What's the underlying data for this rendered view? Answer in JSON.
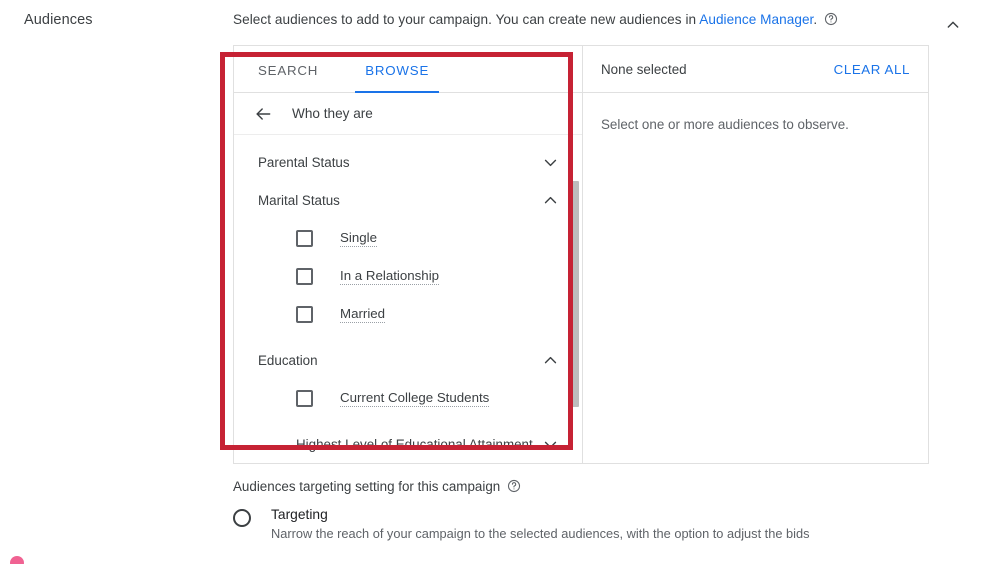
{
  "header": {
    "section_label": "Audiences",
    "description_prefix": "Select audiences to add to your campaign. You can create new audiences in ",
    "link_text": "Audience Manager",
    "description_suffix": ".",
    "help_icon": "help-circle-icon",
    "collapse_icon": "chevron-up-icon"
  },
  "browse_panel": {
    "tabs": [
      {
        "label": "SEARCH",
        "active": false
      },
      {
        "label": "BROWSE",
        "active": true
      }
    ],
    "breadcrumb": {
      "back_icon": "arrow-left-icon",
      "label": "Who they are"
    },
    "items": [
      {
        "type": "group",
        "label": "Parental Status",
        "expanded": false,
        "icon": "chevron-down-icon",
        "indent": false
      },
      {
        "type": "group",
        "label": "Marital Status",
        "expanded": true,
        "icon": "chevron-up-icon",
        "indent": false
      },
      {
        "type": "checkbox",
        "label": "Single",
        "checked": false
      },
      {
        "type": "checkbox",
        "label": "In a Relationship",
        "checked": false
      },
      {
        "type": "checkbox",
        "label": "Married",
        "checked": false
      },
      {
        "type": "group",
        "label": "Education",
        "expanded": true,
        "icon": "chevron-up-icon",
        "indent": false
      },
      {
        "type": "checkbox",
        "label": "Current College Students",
        "checked": false
      },
      {
        "type": "group",
        "label": "Highest Level of Educational Attainment",
        "expanded": false,
        "icon": "chevron-down-icon",
        "indent": true
      }
    ]
  },
  "selection_panel": {
    "count_label": "None selected",
    "clear_all_label": "CLEAR ALL",
    "empty_text": "Select one or more audiences to observe."
  },
  "targeting": {
    "title": "Audiences targeting setting for this campaign",
    "help_icon": "help-circle-icon",
    "option_title": "Targeting",
    "option_description": "Narrow the reach of your campaign to the selected audiences, with the option to adjust the bids",
    "selected": false
  },
  "colors": {
    "accent_blue": "#1a73e8",
    "annotation_red": "#c62234",
    "text_primary": "#3c4043",
    "text_secondary": "#5f6368",
    "pink_dot": "#f06292"
  }
}
